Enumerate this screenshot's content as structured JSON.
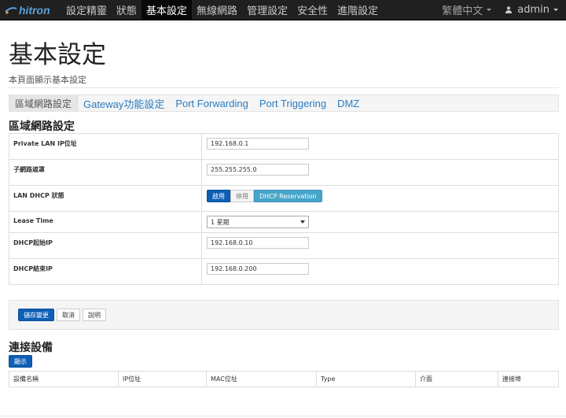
{
  "navbar": {
    "brand": "hitron",
    "items": [
      {
        "label": "設定精靈",
        "active": false
      },
      {
        "label": "狀態",
        "active": false
      },
      {
        "label": "基本設定",
        "active": true
      },
      {
        "label": "無線網路",
        "active": false
      },
      {
        "label": "管理設定",
        "active": false
      },
      {
        "label": "安全性",
        "active": false
      },
      {
        "label": "進階設定",
        "active": false
      }
    ],
    "language": "繁體中文",
    "user": "admin"
  },
  "page": {
    "title": "基本設定",
    "subtitle": "本頁面顯示基本設定"
  },
  "tabs": [
    {
      "label": "區域網路設定",
      "active": true
    },
    {
      "label": "Gateway功能設定",
      "active": false
    },
    {
      "label": "Port Forwarding",
      "active": false
    },
    {
      "label": "Port Triggering",
      "active": false
    },
    {
      "label": "DMZ",
      "active": false
    }
  ],
  "lan": {
    "section_title": "區域網路設定",
    "private_ip_label": "Private LAN IP位址",
    "private_ip_value": "192.168.0.1",
    "subnet_label": "子網路遮罩",
    "subnet_value": "255.255.255.0",
    "dhcp_state_label": "LAN DHCP 狀態",
    "dhcp_enable": "啟用",
    "dhcp_disable": "停用",
    "dhcp_reservation": "DHCP Reservation",
    "lease_label": "Lease Time",
    "lease_value": "1 星期",
    "dhcp_start_label": "DHCP起始IP",
    "dhcp_start_value": "192.168.0.10",
    "dhcp_end_label": "DHCP結束IP",
    "dhcp_end_value": "192.168.0.200"
  },
  "actions": {
    "save": "儲存變更",
    "cancel": "取消",
    "help": "說明"
  },
  "devices": {
    "section_title": "連接設備",
    "show_button": "顯示",
    "columns": [
      "設備名稱",
      "IP位址",
      "MAC位址",
      "Type",
      "介面",
      "連接埠"
    ]
  },
  "colors": {
    "navbar_bg": "#202020",
    "primary_button": "#0e5fb5",
    "info_button": "#45a6c9",
    "link": "#2a7bbf"
  }
}
